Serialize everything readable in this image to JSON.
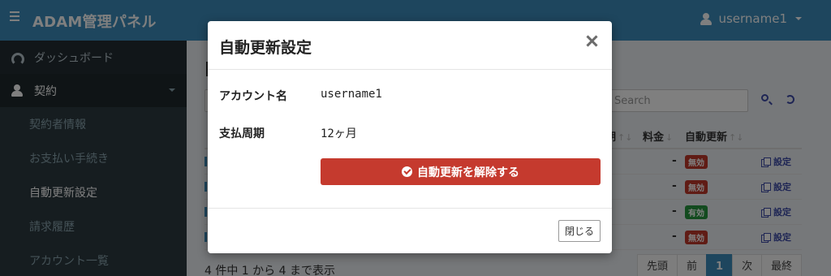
{
  "app": {
    "title": "ADAM管理パネル",
    "username": "username1"
  },
  "sidebar": {
    "items": [
      {
        "label": "ダッシュボード"
      },
      {
        "label": "契約"
      }
    ],
    "sub_items": [
      {
        "label": "契約者情報"
      },
      {
        "label": "お支払い手続き"
      },
      {
        "label": "自動更新設定"
      },
      {
        "label": "請求履歴"
      },
      {
        "label": "アカウント一覧"
      }
    ]
  },
  "main": {
    "search": {
      "placeholder": "Search"
    },
    "table": {
      "headers": {
        "fee": "料金",
        "auto_renew": "自動更新",
        "period_tail": "期"
      },
      "rows": [
        {
          "fee": "-",
          "status": "無効",
          "status_type": "off",
          "action": "設定"
        },
        {
          "fee": "-",
          "status": "無効",
          "status_type": "off",
          "action": "設定"
        },
        {
          "fee": "-",
          "status": "有効",
          "status_type": "on",
          "action": "設定"
        },
        {
          "fee": "-",
          "status": "無効",
          "status_type": "off",
          "action": "設定"
        }
      ]
    },
    "footer_info": "4 件中 1 から 4 まで表示",
    "pagination": {
      "first": "先頭",
      "prev": "前",
      "current": "1",
      "next": "次",
      "last": "最終"
    }
  },
  "modal": {
    "title": "自動更新設定",
    "account_label": "アカウント名",
    "account_value": "username1",
    "period_label": "支払周期",
    "period_value": "12ヶ月",
    "cancel_button": "自動更新を解除する",
    "close_button": "閉じる"
  },
  "colors": {
    "header_bg": "#3c8dbc",
    "sidebar_bg": "#222d32",
    "danger": "#c53a2e",
    "badge_off": "#c0392b",
    "badge_on": "#27963f"
  }
}
